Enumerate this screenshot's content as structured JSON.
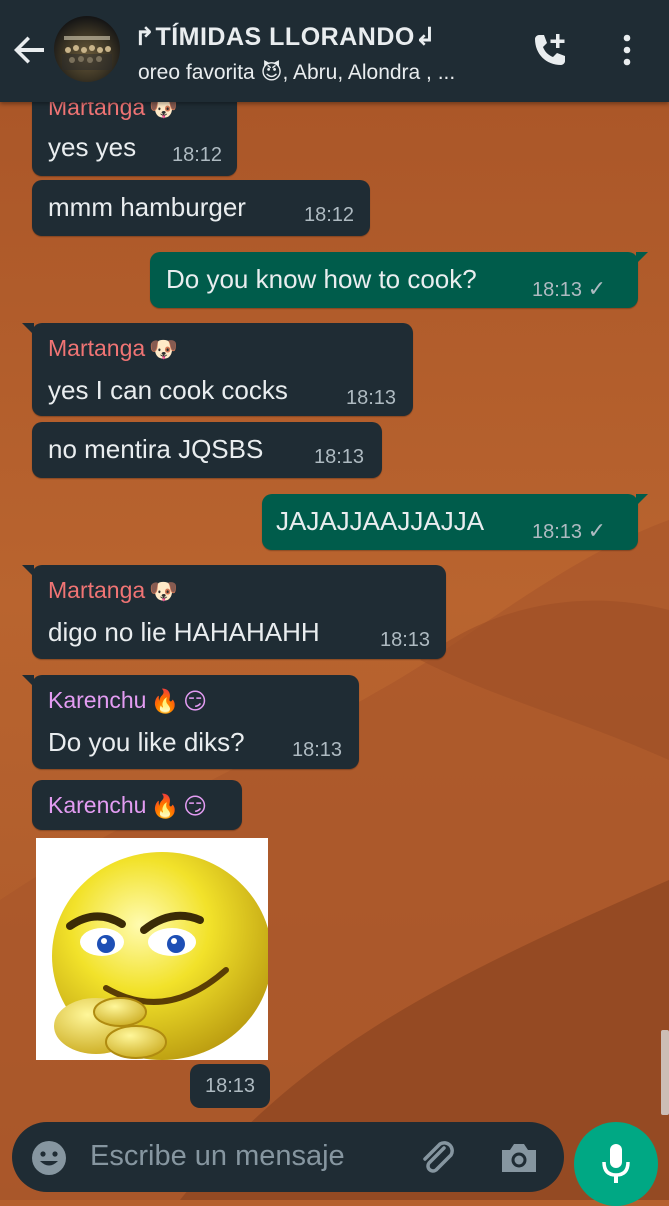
{
  "header": {
    "title": "↱TÍMIDAS LLORANDO↲",
    "subtitle": "oreo favorita 😈, Abru, Alondra , ..."
  },
  "messages": [
    {
      "sender": "Martanga",
      "text": "yes yes",
      "time": "18:12"
    },
    {
      "text": "mmm hamburger",
      "time": "18:12"
    },
    {
      "text": "Do you know how to cook?",
      "time": "18:13"
    },
    {
      "sender": "Martanga",
      "text": "yes I can cook cocks",
      "time": "18:13"
    },
    {
      "text": "no mentira JQSBS",
      "time": "18:13"
    },
    {
      "text": "JAJAJJAAJJAJJA",
      "time": "18:13"
    },
    {
      "sender": "Martanga",
      "text": "digo no lie HAHAHAHH",
      "time": "18:13"
    },
    {
      "sender": "Karenchu",
      "text": "Do you like diks?",
      "time": "18:13"
    },
    {
      "sender": "Karenchu"
    }
  ],
  "sticker": {
    "time": "18:13",
    "icon": "smirking-emoji-sticker"
  },
  "input": {
    "placeholder": "Escribe un mensaje"
  },
  "colors": {
    "header_bg": "#1f2c34",
    "incoming_bubble": "#1f2c34",
    "outgoing_bubble": "#005c4b",
    "martanga_name": "#f07474",
    "karenchu_name": "#e39cf2",
    "mic_button": "#00a884"
  }
}
